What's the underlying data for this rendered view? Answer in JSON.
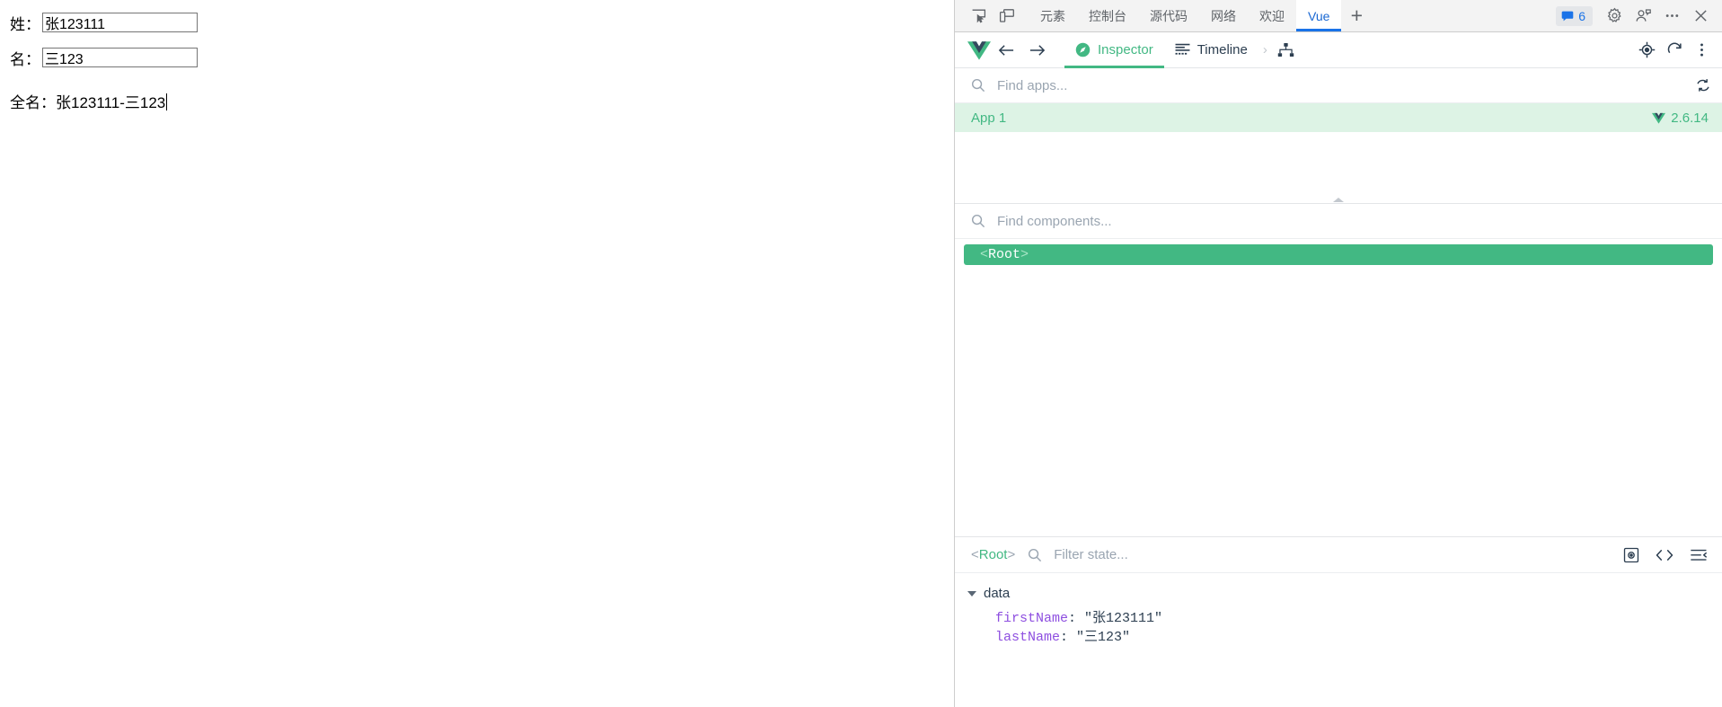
{
  "page": {
    "fields": [
      {
        "label": "姓：",
        "value": "张123111",
        "name": "first-name-input"
      },
      {
        "label": "名：",
        "value": "三123",
        "name": "last-name-input"
      }
    ],
    "fullname_label": "全名：",
    "fullname_value": "张123111-三123"
  },
  "devtools": {
    "tabs": [
      {
        "label": "元素",
        "active": false
      },
      {
        "label": "控制台",
        "active": false
      },
      {
        "label": "源代码",
        "active": false
      },
      {
        "label": "网络",
        "active": false
      },
      {
        "label": "欢迎",
        "active": false
      },
      {
        "label": "Vue",
        "active": true
      }
    ],
    "new_tab_label": "+",
    "message_count": "6",
    "accent_blue": "#1a73e8"
  },
  "vue": {
    "tabs": [
      {
        "label": "Inspector",
        "active": true
      },
      {
        "label": "Timeline",
        "active": false
      }
    ],
    "separator": "›",
    "accent_green": "#42b883",
    "apps_search_placeholder": "Find apps...",
    "components_search_placeholder": "Find components...",
    "apps": [
      {
        "name": "App 1",
        "version": "2.6.14"
      }
    ],
    "tree": [
      {
        "open_bracket": "<",
        "name": "Root",
        "close_bracket": ">"
      }
    ],
    "state": {
      "root_open": "<",
      "root_name": "Root",
      "root_close": ">",
      "filter_placeholder": "Filter state...",
      "group_label": "data",
      "entries": [
        {
          "key": "firstName",
          "sep": ": ",
          "value": "\"张123111\""
        },
        {
          "key": "lastName",
          "sep": ": ",
          "value": "\"三123\""
        }
      ]
    }
  }
}
